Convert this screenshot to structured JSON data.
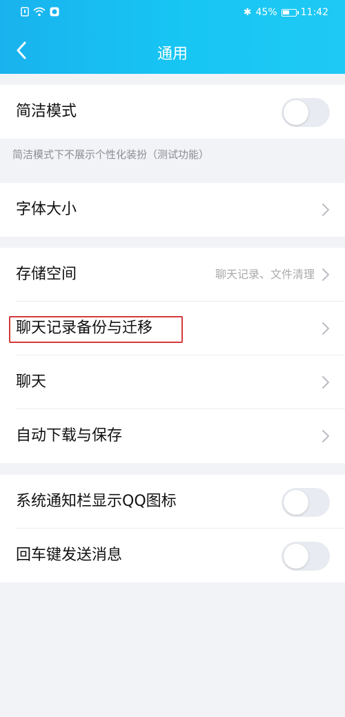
{
  "status_bar": {
    "left_icons": [
      "sim-icon",
      "wifi-icon",
      "app-notification-icon"
    ],
    "bluetooth": "✱",
    "battery_percent": "45%",
    "time": "11:42"
  },
  "header": {
    "title": "通用",
    "back_icon": "chevron-left-icon"
  },
  "section_simple": {
    "label": "简洁模式",
    "toggle_on": false,
    "note": "简洁模式下不展示个性化装扮（测试功能）"
  },
  "section_font": {
    "label": "字体大小"
  },
  "section_storage": {
    "items": [
      {
        "label": "存储空间",
        "hint": "聊天记录、文件清理"
      },
      {
        "label": "聊天记录备份与迁移"
      },
      {
        "label": "聊天"
      },
      {
        "label": "自动下载与保存"
      }
    ]
  },
  "section_toggles": {
    "items": [
      {
        "label": "系统通知栏显示QQ图标",
        "toggle_on": false
      },
      {
        "label": "回车键发送消息",
        "toggle_on": false
      }
    ]
  },
  "colors": {
    "header": "#19b2ee",
    "highlight": "#d3393a",
    "toggle_off": "#e8ebf1"
  }
}
